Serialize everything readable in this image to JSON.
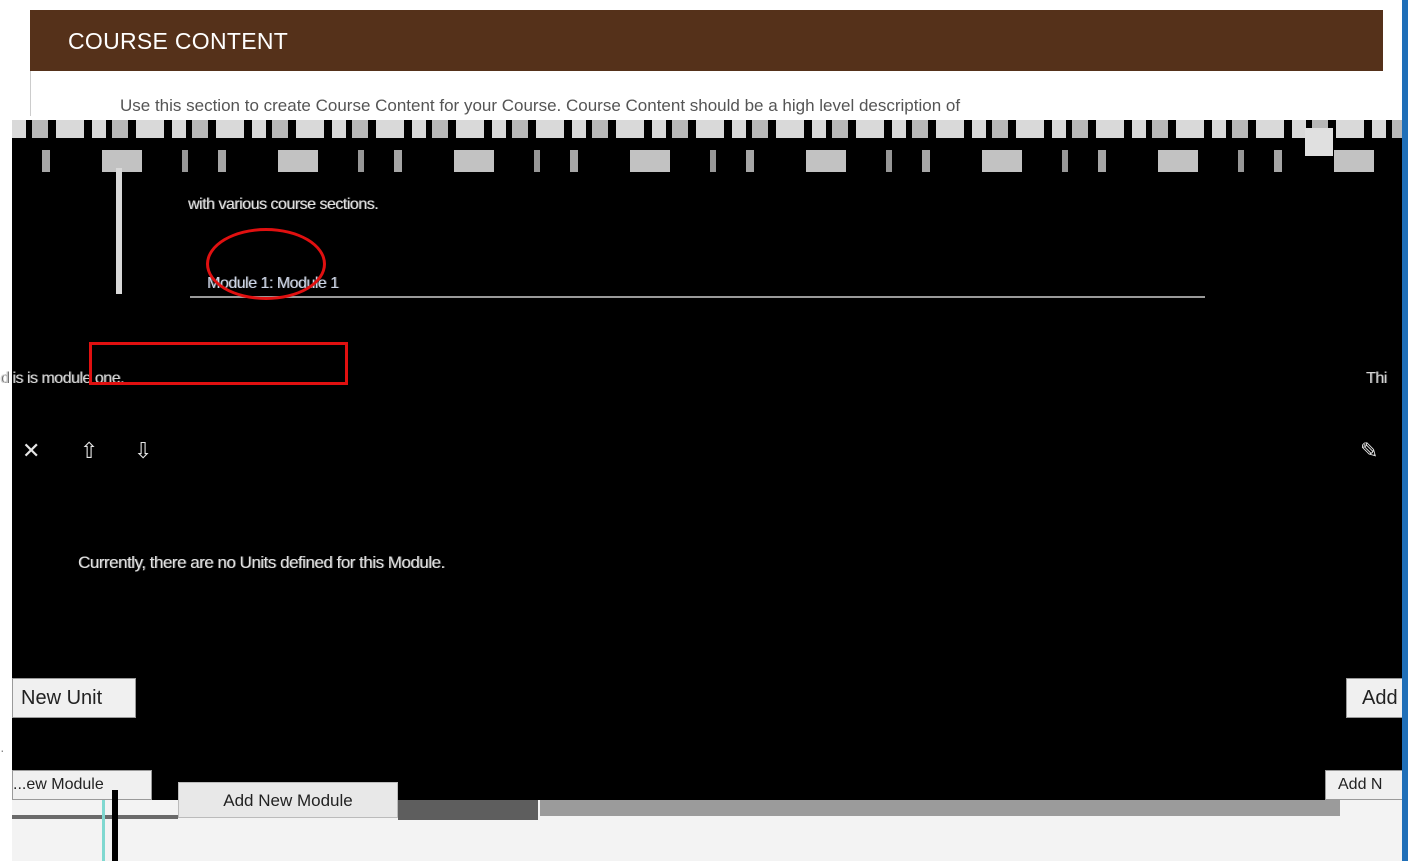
{
  "header": {
    "title": "COURSE CONTENT"
  },
  "intro": {
    "text": "Use this section to create Course Content for your Course. Course Content should be a high level description of",
    "continuation": "with various course sections."
  },
  "module": {
    "link_text": "Module 1: Module 1",
    "description_left": "d is is module one.",
    "description_right": "Thi",
    "no_units_text": "Currently, there are no Units defined for this Module."
  },
  "icons": {
    "delete": "close-x-icon",
    "move_up": "arrow-up-icon",
    "move_down": "arrow-down-icon",
    "edit": "pencil-edit-icon"
  },
  "buttons": {
    "new_unit": "New Unit",
    "add_right": "Add",
    "new_module_left": "...ew Module",
    "add_right_2": "Add N",
    "add_new_module": "Add New Module"
  },
  "colors": {
    "header_bg": "#55311a",
    "annotation": "#e01010"
  }
}
